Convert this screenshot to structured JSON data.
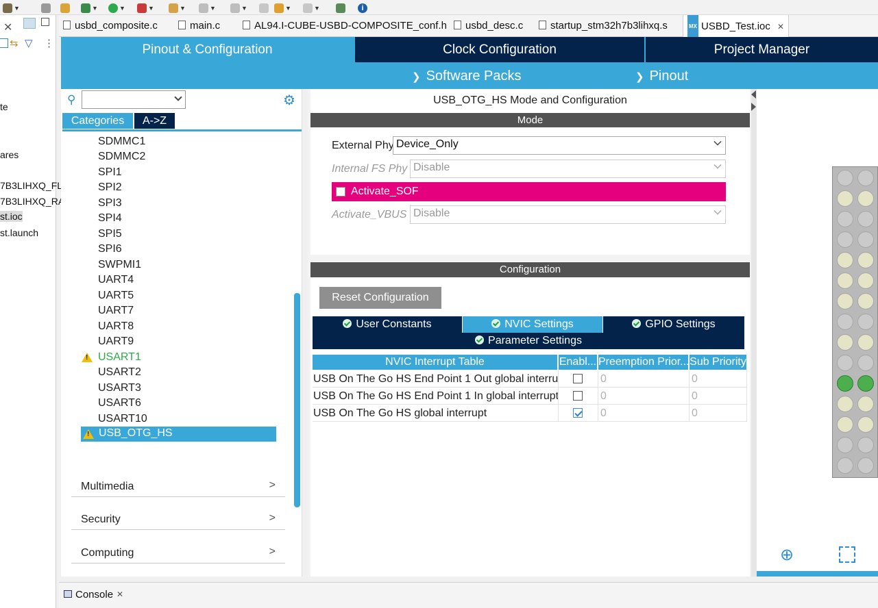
{
  "toolbar": {
    "icons": [
      "hammer-icon",
      "build-icon",
      "debug-icon",
      "run-icon",
      "external-tools-icon",
      "search-icon",
      "navigate-back-icon",
      "navigate-forward-icon",
      "open-perspective-icon",
      "info-icon"
    ]
  },
  "explorer": {
    "items": [
      "te",
      "ares",
      "7B3LIHXQ_FL",
      "7B3LIHXQ_RA",
      "st.ioc",
      "st.launch"
    ]
  },
  "file_tabs": [
    {
      "label": "usbd_composite.c"
    },
    {
      "label": "main.c"
    },
    {
      "label": "AL94.I-CUBE-USBD-COMPOSITE_conf.h"
    },
    {
      "label": "usbd_desc.c"
    },
    {
      "label": "startup_stm32h7b3lihxq.s"
    },
    {
      "label": "USBD_Test.ioc",
      "active": true,
      "badge": "MX"
    }
  ],
  "header": {
    "tabs": [
      "Pinout & Configuration",
      "Clock Configuration",
      "Project Manager"
    ],
    "menus": [
      "Software Packs",
      "Pinout"
    ]
  },
  "categories": {
    "search_placeholder": "",
    "tab_categories": "Categories",
    "tab_az": "A->Z",
    "items": [
      {
        "label": "SDMMC1"
      },
      {
        "label": "SDMMC2"
      },
      {
        "label": "SPI1"
      },
      {
        "label": "SPI2"
      },
      {
        "label": "SPI3"
      },
      {
        "label": "SPI4"
      },
      {
        "label": "SPI5"
      },
      {
        "label": "SPI6"
      },
      {
        "label": "SWPMI1"
      },
      {
        "label": "UART4"
      },
      {
        "label": "UART5"
      },
      {
        "label": "UART7"
      },
      {
        "label": "UART8"
      },
      {
        "label": "UART9"
      },
      {
        "label": "USART1",
        "warning": true,
        "color": "#2ea84a"
      },
      {
        "label": "USART2"
      },
      {
        "label": "USART3"
      },
      {
        "label": "USART6"
      },
      {
        "label": "USART10"
      },
      {
        "label": "USB_OTG_HS",
        "warning": true,
        "selected": true
      }
    ],
    "sections": [
      "Multimedia",
      "Security",
      "Computing"
    ]
  },
  "mode": {
    "title": "USB_OTG_HS Mode and Configuration",
    "section_label": "Mode",
    "external_phy_label": "External Phy",
    "external_phy_value": "Device_Only",
    "internal_fs_phy_label": "Internal FS Phy",
    "internal_fs_phy_value": "Disable",
    "activate_sof_label": "Activate_SOF",
    "activate_vbus_label": "Activate_VBUS",
    "activate_vbus_value": "Disable"
  },
  "configuration": {
    "section_label": "Configuration",
    "reset_button": "Reset Configuration",
    "tabs": [
      "User Constants",
      "NVIC Settings",
      "GPIO Settings",
      "Parameter Settings"
    ],
    "active_tab": "NVIC Settings"
  },
  "nvic": {
    "columns": [
      "NVIC Interrupt Table",
      "Enabl...",
      "Preemption Prior...",
      "Sub Priority"
    ],
    "rows": [
      {
        "name": "USB On The Go HS End Point 1 Out global interru...",
        "enabled": false,
        "preemption": "0",
        "sub": "0"
      },
      {
        "name": "USB On The Go HS End Point 1 In global interrupt",
        "enabled": false,
        "preemption": "0",
        "sub": "0"
      },
      {
        "name": "USB On The Go HS global interrupt",
        "enabled": true,
        "preemption": "0",
        "sub": "0"
      }
    ]
  },
  "chip_view": {
    "controls": [
      "zoom-in-icon",
      "fit-screen-icon"
    ]
  },
  "console": {
    "title": "Console"
  },
  "colors": {
    "header_blue": "#39a8d9",
    "dark_navy": "#03234b",
    "section_grey": "#525252",
    "activate_sof_magenta": "#e5007e",
    "warning_yellow": "#f0c000"
  }
}
